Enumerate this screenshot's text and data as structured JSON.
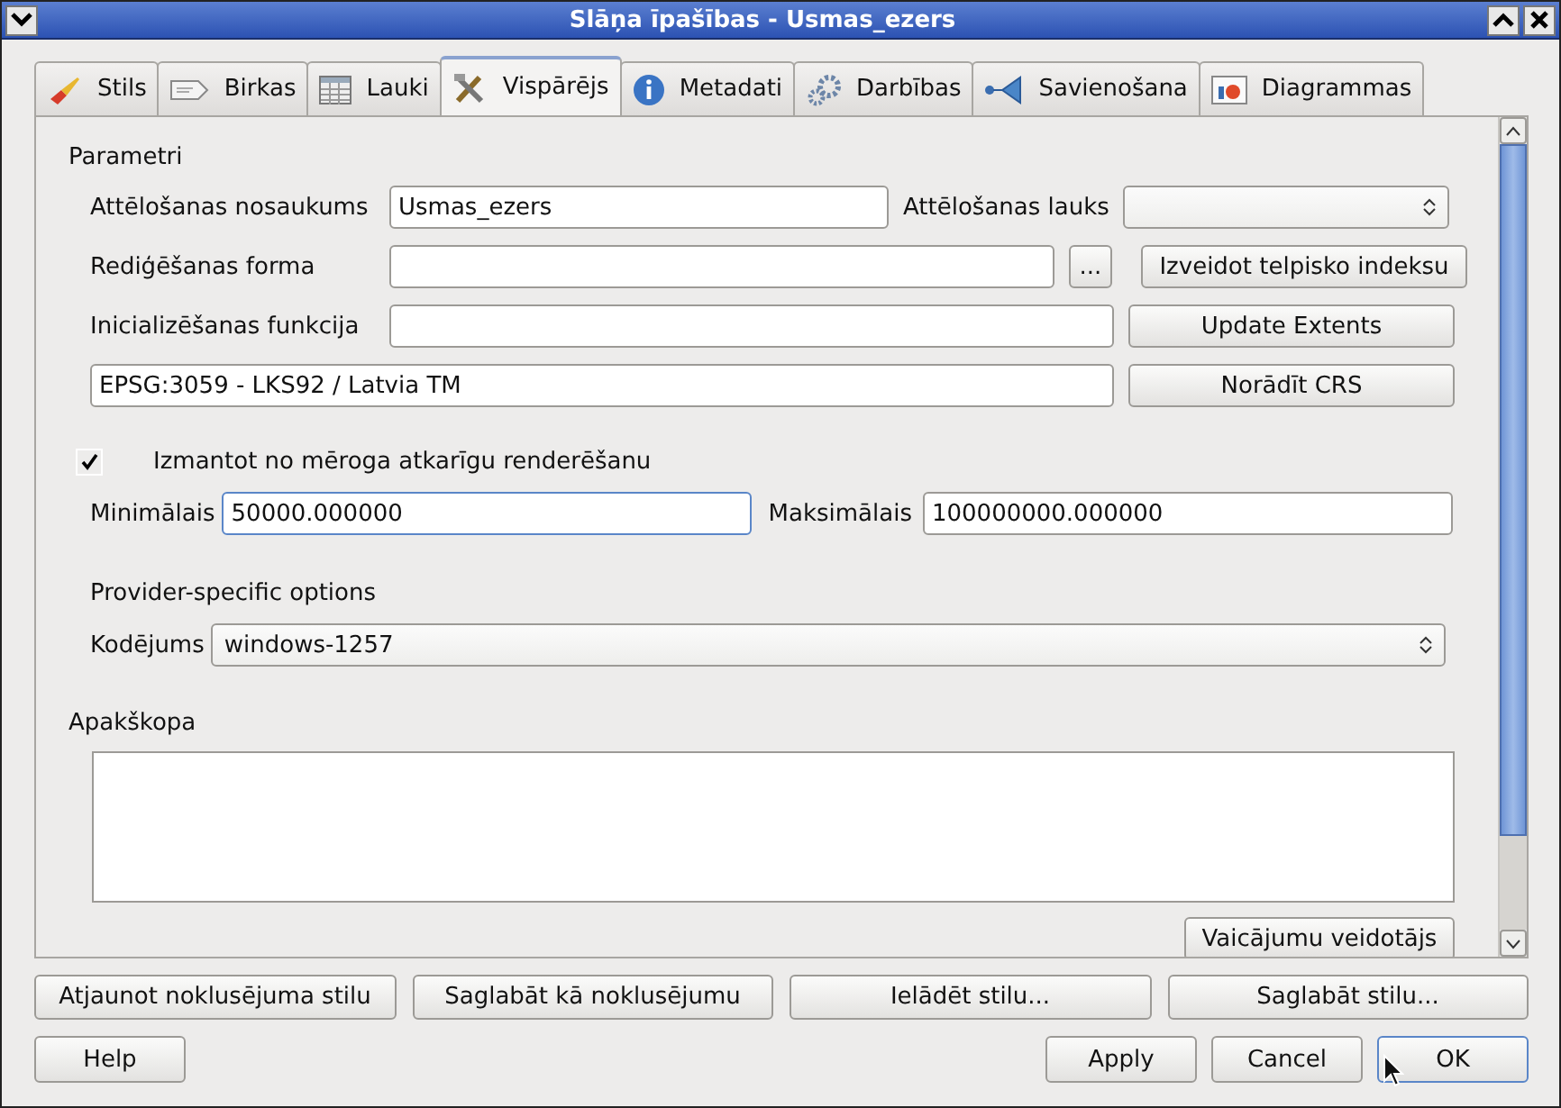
{
  "window": {
    "title": "Slāņa īpašības - Usmas_ezers"
  },
  "tabs": [
    {
      "label": "Stils",
      "selected": false
    },
    {
      "label": "Birkas",
      "selected": false
    },
    {
      "label": "Lauki",
      "selected": false
    },
    {
      "label": "Vispārējs",
      "selected": true
    },
    {
      "label": "Metadati",
      "selected": false
    },
    {
      "label": "Darbības",
      "selected": false
    },
    {
      "label": "Savienošana",
      "selected": false
    },
    {
      "label": "Diagrammas",
      "selected": false
    }
  ],
  "general": {
    "section": "Parametri",
    "display_name_label": "Attēlošanas nosaukums",
    "display_name_value": "Usmas_ezers",
    "display_field_label": "Attēlošanas lauks",
    "edit_form_label": "Rediģēšanas forma",
    "browse_button": "...",
    "spatial_index_button": "Izveidot telpisko indeksu",
    "init_function_label": "Inicializēšanas funkcija",
    "update_extents_button": "Update Extents",
    "crs_value": "EPSG:3059 - LKS92 / Latvia TM",
    "crs_button": "Norādīt CRS"
  },
  "scale": {
    "label": "Izmantot no mēroga atkarīgu renderēšanu",
    "checked": true,
    "min_label": "Minimālais",
    "min_value": "50000.000000",
    "min_focused": true,
    "max_label": "Maksimālais",
    "max_value": "100000000.000000"
  },
  "provider": {
    "section": "Provider-specific options",
    "encoding_label": "Kodējums",
    "encoding_value": "windows-1257"
  },
  "subset": {
    "section": "Apakškopa",
    "query_builder_button": "Vaicājumu veidotājs"
  },
  "style_buttons": [
    "Atjaunot noklusējuma stilu",
    "Saglabāt kā noklusējumu",
    "Ielādēt stilu...",
    "Saglabāt stilu..."
  ],
  "help_button": "Help",
  "dialog_buttons": [
    {
      "label": "Apply",
      "focused": false
    },
    {
      "label": "Cancel",
      "focused": false
    },
    {
      "label": "OK",
      "focused": true
    }
  ]
}
